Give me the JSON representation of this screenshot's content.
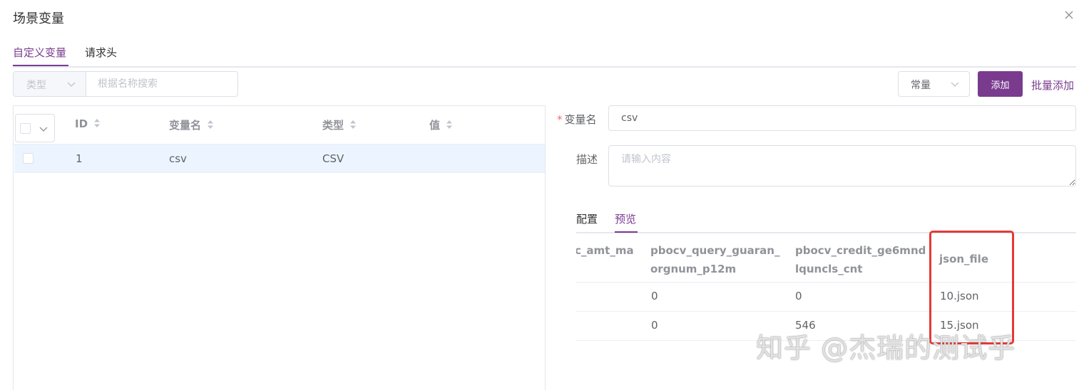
{
  "dialog": {
    "title": "场景变量"
  },
  "tabs": [
    {
      "label": "自定义变量"
    },
    {
      "label": "请求头"
    }
  ],
  "filter": {
    "type_placeholder": "类型",
    "search_placeholder": "根据名称搜索"
  },
  "toolbar": {
    "type_select_value": "常量",
    "add_label": "添加",
    "batch_add_label": "批量添加"
  },
  "table": {
    "columns": [
      "ID",
      "变量名",
      "类型",
      "值"
    ],
    "rows": [
      {
        "id": "1",
        "name": "csv",
        "type": "CSV",
        "value": ""
      }
    ]
  },
  "form": {
    "name_label": "变量名",
    "name_value": "csv",
    "desc_label": "描述",
    "desc_placeholder": "请输入内容"
  },
  "sub_tabs": [
    {
      "label": "配置"
    },
    {
      "label": "预览"
    }
  ],
  "preview": {
    "columns": [
      "c_amt_ma",
      "pbocv_query_guaran_orgnum_p12m",
      "pbocv_credit_ge6mndlquncls_cnt",
      "json_file"
    ],
    "rows": [
      [
        "",
        "0",
        "0",
        "10.json"
      ],
      [
        "",
        "0",
        "546",
        "15.json"
      ]
    ]
  },
  "watermark": "知乎 @杰瑞的测试乎",
  "colors": {
    "accent": "#7a3b8f",
    "highlight": "#e53935",
    "row_selected": "#ecf5ff"
  }
}
